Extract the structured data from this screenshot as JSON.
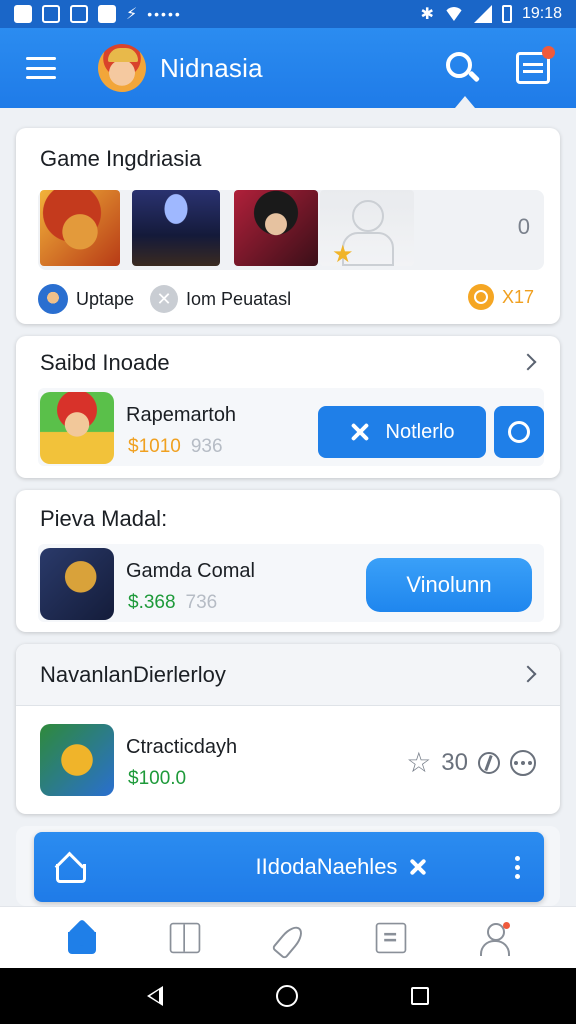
{
  "status_bar": {
    "time": "19:18",
    "dots": "•••••"
  },
  "app_bar": {
    "title": "Nidnasia"
  },
  "card_featured": {
    "title": "Game Ingdriasia",
    "strip_count": "0",
    "footer_label": "Uptape",
    "footer_action": "Iom Peuatasl",
    "coin_count": "X17"
  },
  "card_sale": {
    "title": "Saibd Inoade",
    "game_name": "Rapemartoh",
    "price": "$1010",
    "old_price": "936",
    "button_label": "Notlerlo"
  },
  "card_mobile": {
    "title": "Pieva Madal:",
    "game_name": "Gamda Comal",
    "price": "$.368",
    "old_price": "736",
    "button_label": "Vinolunn"
  },
  "card_new": {
    "title": "NavanlanDierlerloy",
    "game_name": "Ctracticdayh",
    "price": "$100.0",
    "rating": "30"
  },
  "banner": {
    "text": "IIdodaNaehles"
  },
  "colors": {
    "primary": "#1f7fe8",
    "price_orange": "#f0a020",
    "price_green": "#1e9a3a",
    "badge_red": "#ef5a3c"
  }
}
